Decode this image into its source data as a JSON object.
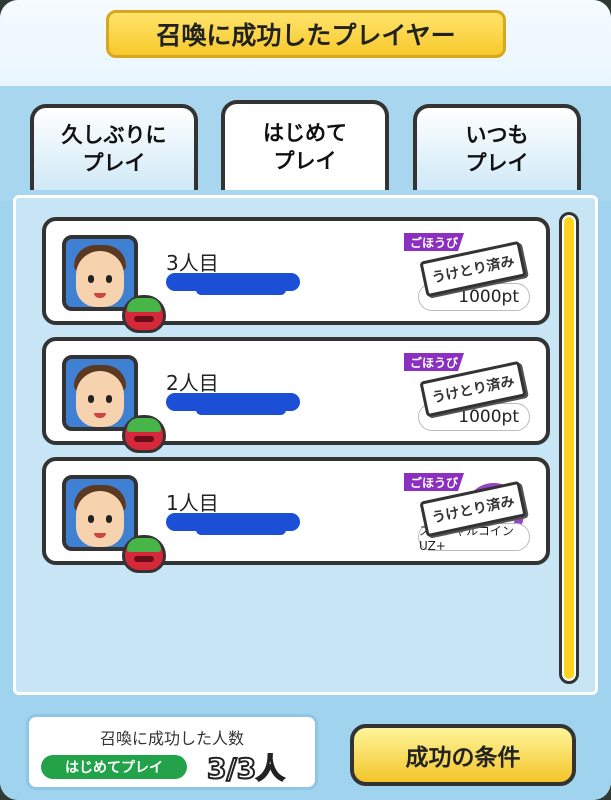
{
  "title": "召喚に成功したプレイヤー",
  "tabs": [
    {
      "label": "久しぶりに\nプレイ",
      "active": false
    },
    {
      "label": "はじめて\nプレイ",
      "active": true
    },
    {
      "label": "いつも\nプレイ",
      "active": false
    }
  ],
  "players": [
    {
      "rank": "3人目",
      "reward_tag": "ごほうび",
      "stamp": "うけとり済み",
      "reward": "1000pt"
    },
    {
      "rank": "2人目",
      "reward_tag": "ごほうび",
      "stamp": "うけとり済み",
      "reward": "1000pt"
    },
    {
      "rank": "1人目",
      "reward_tag": "ごほうび",
      "stamp": "うけとり済み",
      "reward": "スペシャルコインUZ+"
    }
  ],
  "summary": {
    "title": "召喚に成功した人数",
    "badge": "はじめてプレイ",
    "count": "3/3人"
  },
  "condition_button": "成功の条件",
  "colors": {
    "accent_yellow": "#ffd21f",
    "reward_purple": "#8a2fbf",
    "badge_green": "#22a34a"
  }
}
